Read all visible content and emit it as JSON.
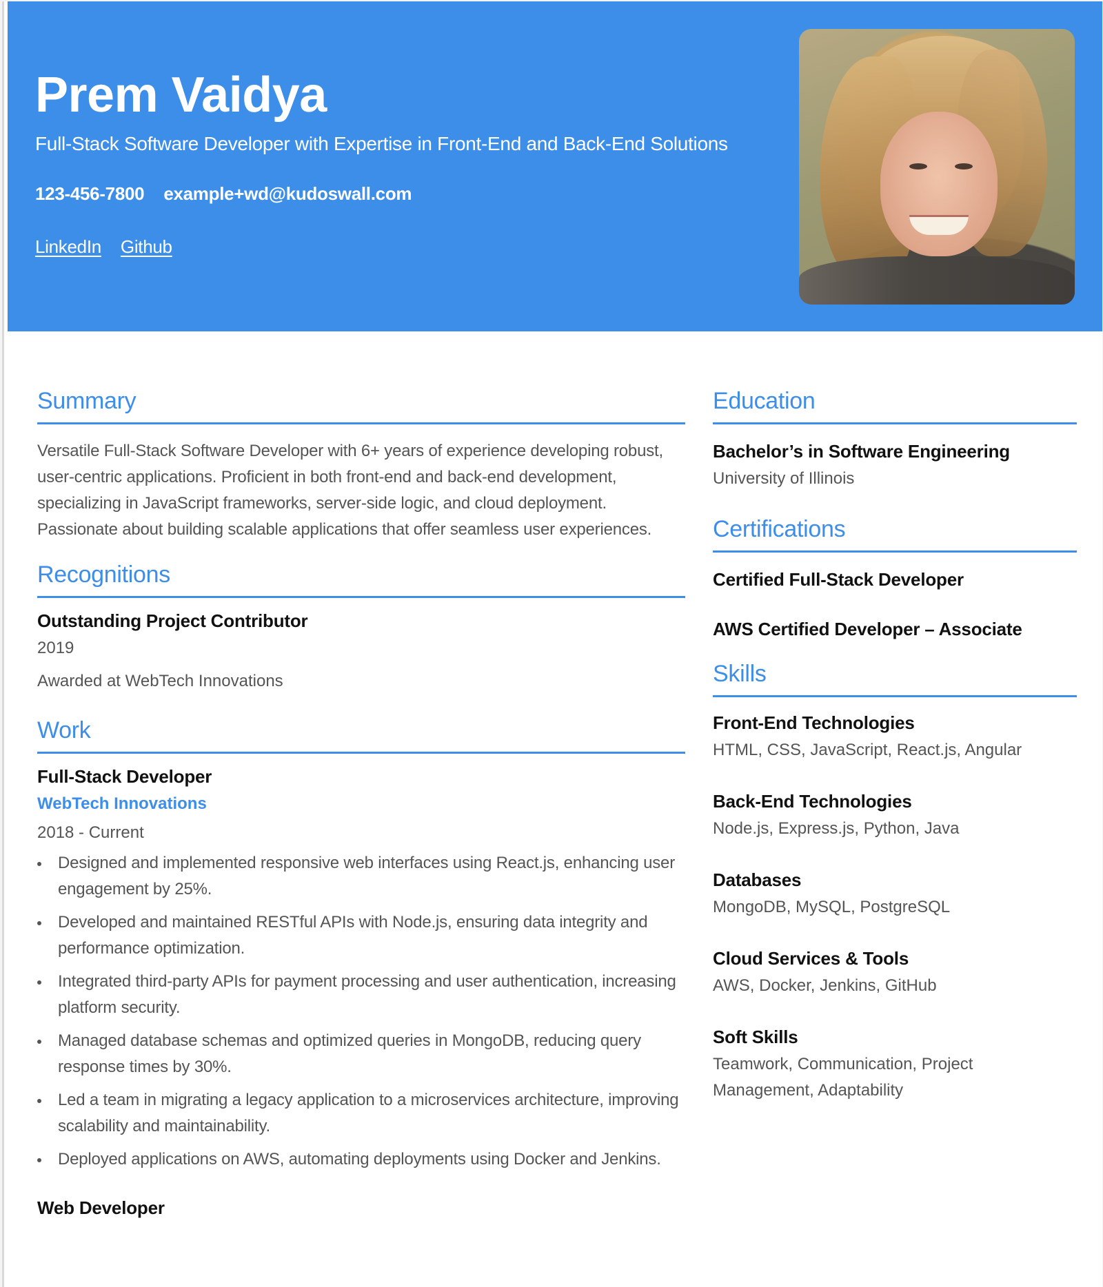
{
  "header": {
    "name": "Prem Vaidya",
    "tagline": "Full-Stack Software Developer with Expertise in Front-End and Back-End Solutions",
    "phone": "123-456-7800",
    "email": "example+wd@kudoswall.com",
    "links": [
      {
        "label": "LinkedIn"
      },
      {
        "label": "Github"
      }
    ],
    "photo_icon": "profile-photo"
  },
  "summary": {
    "title": "Summary",
    "text": "Versatile Full-Stack Software Developer with 6+ years of experience developing robust, user-centric applications. Proficient in both front-end and back-end development, specializing in JavaScript frameworks, server-side logic, and cloud deployment. Passionate about building scalable applications that offer seamless user experiences."
  },
  "recognitions": {
    "title": "Recognitions",
    "items": [
      {
        "title": "Outstanding Project Contributor",
        "year": "2019",
        "description": "Awarded at WebTech Innovations"
      }
    ]
  },
  "work": {
    "title": "Work",
    "items": [
      {
        "title": "Full-Stack Developer",
        "company": "WebTech Innovations",
        "dates": "2018 - Current",
        "bullets": [
          "Designed and implemented responsive web interfaces using React.js, enhancing user engagement by 25%.",
          "Developed and maintained RESTful APIs with Node.js, ensuring data integrity and performance optimization.",
          "Integrated third-party APIs for payment processing and user authentication, increasing platform security.",
          "Managed database schemas and optimized queries in MongoDB, reducing query response times by 30%.",
          "Led a team in migrating a legacy application to a microservices architecture, improving scalability and maintainability.",
          "Deployed applications on AWS, automating deployments using Docker and Jenkins."
        ]
      },
      {
        "title": "Web Developer"
      }
    ]
  },
  "education": {
    "title": "Education",
    "items": [
      {
        "degree": "Bachelor’s in Software Engineering",
        "school": "University of Illinois"
      }
    ]
  },
  "certifications": {
    "title": "Certifications",
    "items": [
      "Certified Full-Stack Developer",
      "AWS Certified Developer – Associate"
    ]
  },
  "skills": {
    "title": "Skills",
    "groups": [
      {
        "name": "Front-End Technologies",
        "items": "HTML, CSS, JavaScript, React.js, Angular"
      },
      {
        "name": "Back-End Technologies",
        "items": "Node.js, Express.js, Python, Java"
      },
      {
        "name": "Databases",
        "items": "MongoDB, MySQL, PostgreSQL"
      },
      {
        "name": "Cloud Services & Tools",
        "items": "AWS, Docker, Jenkins, GitHub"
      },
      {
        "name": "Soft Skills",
        "items": "Teamwork, Communication, Project Management, Adaptability"
      }
    ]
  },
  "colors": {
    "accent": "#3d8ee8",
    "body_text": "#555555",
    "title_text": "#111111"
  }
}
